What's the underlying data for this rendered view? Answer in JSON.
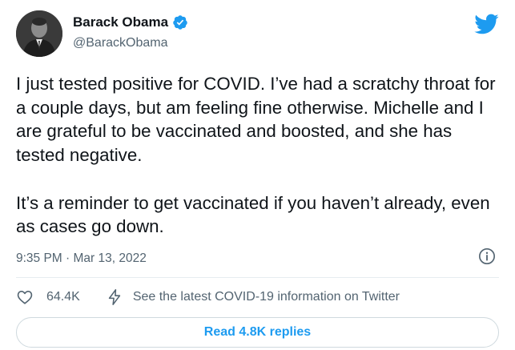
{
  "author": {
    "display_name": "Barack Obama",
    "handle": "@BarackObama",
    "verified": true
  },
  "tweet": {
    "text": "I just tested positive for COVID. I’ve had a scratchy throat for a couple days, but am feeling fine otherwise. Michelle and I are grateful to be vaccinated and boosted, and she has tested negative.\n\nIt’s a reminder to get vaccinated if you haven’t already, even as cases go down.",
    "timestamp": "9:35 PM · Mar 13, 2022"
  },
  "actions": {
    "likes": "64.4K",
    "covid_info": "See the latest COVID-19 information on Twitter"
  },
  "replies_button": "Read 4.8K replies",
  "icons": {
    "avatar": "avatar-photo",
    "verified": "verified-badge-icon",
    "logo": "twitter-bird-icon",
    "info": "info-icon",
    "like": "heart-icon",
    "covid": "lightning-bolt-icon"
  },
  "colors": {
    "accent": "#1d9bf0",
    "text": "#0f1419",
    "secondary": "#536471",
    "twitter_blue": "#1d9bf0"
  }
}
